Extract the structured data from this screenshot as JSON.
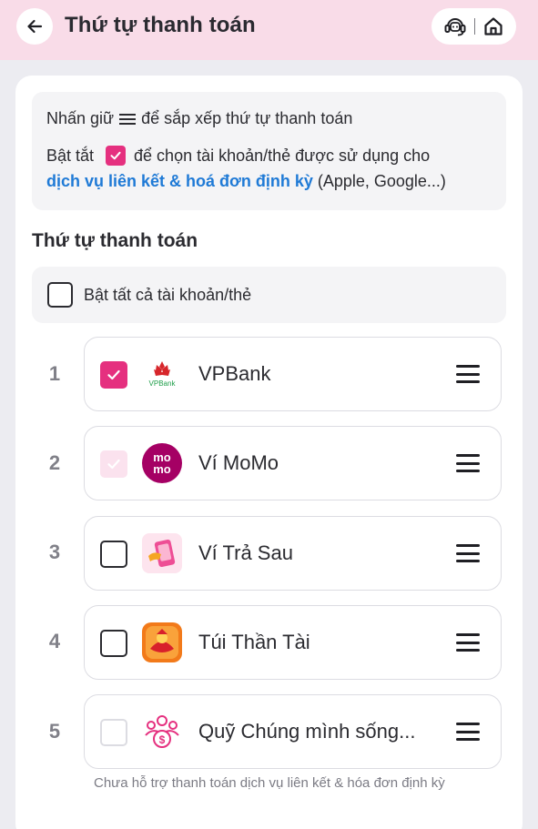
{
  "header": {
    "title": "Thứ tự thanh toán"
  },
  "info": {
    "line1_before": "Nhấn giữ",
    "line1_after": "để sắp xếp thứ tự thanh toán",
    "line2_before": "Bật tắt",
    "line2_after": "để chọn tài khoản/thẻ được sử dụng cho",
    "link": "dịch vụ liên kết & hoá đơn định kỳ",
    "line3_after": " (Apple, Google...)"
  },
  "section_title": "Thứ tự thanh toán",
  "toggle_all_label": "Bật tất cả tài khoản/thẻ",
  "rows": [
    {
      "index": "1",
      "name": "VPBank",
      "checked": "on",
      "logo": "vpbank-logo",
      "logo_text": "VPBank"
    },
    {
      "index": "2",
      "name": "Ví MoMo",
      "checked": "disabled-on",
      "logo": "momo-logo",
      "logo_text": "mo mo"
    },
    {
      "index": "3",
      "name": "Ví Trả Sau",
      "checked": "off",
      "logo": "tra-sau-logo"
    },
    {
      "index": "4",
      "name": "Túi Thần Tài",
      "checked": "off",
      "logo": "than-tai-logo"
    },
    {
      "index": "5",
      "name": "Quỹ Chúng mình sống...",
      "checked": "disabled-off",
      "logo": "group-fund-logo"
    }
  ],
  "row5_note": "Chưa hỗ trợ thanh toán dịch vụ liên kết & hóa đơn định kỳ",
  "colors": {
    "accent": "#e5307f",
    "header_bg": "#f9dce8",
    "link": "#1f7ad6"
  }
}
